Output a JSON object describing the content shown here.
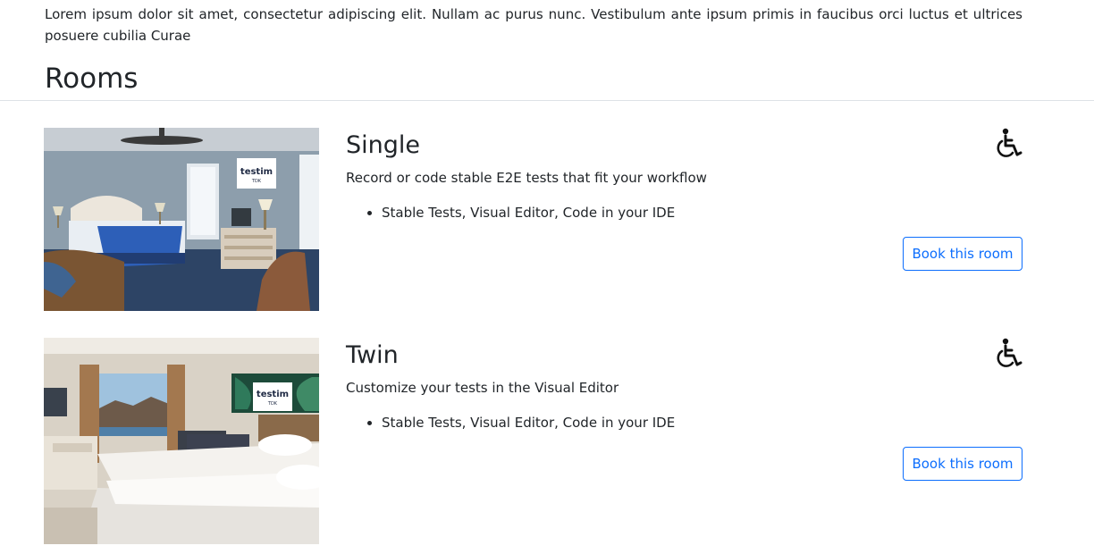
{
  "intro": {
    "text": "Lorem ipsum dolor sit amet, consectetur adipiscing elit. Nullam ac purus nunc. Vestibulum ante ipsum primis in faucibus orci luctus et ultrices posuere cubilia Curae"
  },
  "rooms_section": {
    "title": "Rooms"
  },
  "rooms": [
    {
      "name": "Single",
      "description": "Record or code stable E2E tests that fit your workflow",
      "features": [
        "Stable Tests, Visual Editor, Code in your IDE"
      ],
      "book_label": "Book this room",
      "photo_logo": "testim",
      "photo_logo_sub": "TDK",
      "accessibility_icon": "wheelchair-icon"
    },
    {
      "name": "Twin",
      "description": "Customize your tests in the Visual Editor",
      "features": [
        "Stable Tests, Visual Editor, Code in your IDE"
      ],
      "book_label": "Book this room",
      "photo_logo": "testim",
      "photo_logo_sub": "TDK",
      "accessibility_icon": "wheelchair-icon"
    }
  ],
  "colors": {
    "text": "#212529",
    "accent": "#0d6efd",
    "divider": "#dee2e6"
  }
}
